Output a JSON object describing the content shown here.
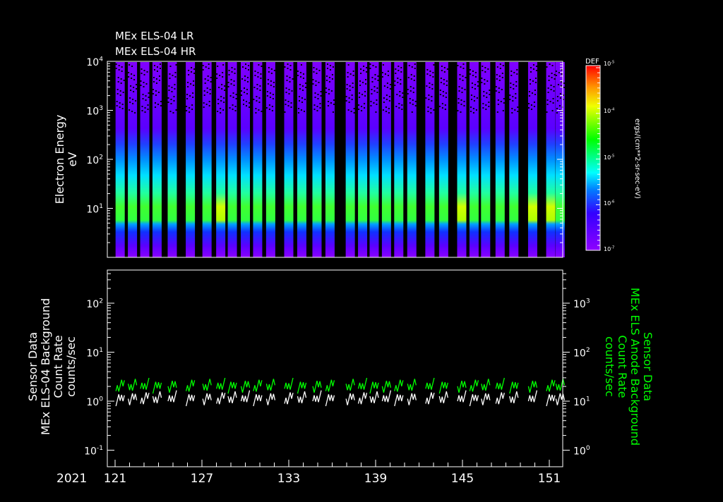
{
  "titles": [
    "MEx ELS-04 LR",
    "MEx ELS-04 HR"
  ],
  "year_label": "2021",
  "colors": {
    "background": "#000000",
    "axis": "#ffffff",
    "white_series": "#ffffff",
    "green_series": "#00ff00"
  },
  "chart_data": [
    {
      "type": "heatmap",
      "title": "MEx ELS-04 LR / HR",
      "ylabel": "Electron Energy",
      "yunits": "eV",
      "yscale": "log",
      "ylim": [
        1,
        10000
      ],
      "yticks": [
        "10^4",
        "10^3",
        "10^2",
        "10^1"
      ],
      "xlim": [
        121,
        151.93
      ],
      "colorbar": {
        "label": "DEF",
        "units": "ergs/(cm**2-sr-sec-eV)",
        "range": [
          1e-07,
          1e-05
        ],
        "ticks": [
          "10^-5",
          "10^-4",
          "10^-5",
          "10^-6",
          "10^-7"
        ]
      },
      "orbit_days": [
        121.35,
        122.2,
        123.05,
        123.9,
        124.95,
        126.2,
        127.35,
        128.3,
        129.1,
        130.0,
        130.85,
        131.75,
        133.0,
        133.9,
        134.95,
        135.85,
        137.25,
        138.1,
        138.9,
        139.75,
        140.6,
        141.5,
        142.75,
        143.7,
        144.95,
        145.8,
        146.6,
        147.6,
        148.55,
        149.85,
        151.1,
        151.75
      ],
      "orbit_peak_intensity": [
        0.55,
        0.6,
        0.55,
        0.6,
        0.6,
        0.55,
        0.7,
        0.72,
        0.65,
        0.6,
        0.62,
        0.6,
        0.55,
        0.6,
        0.62,
        0.58,
        0.62,
        0.65,
        0.6,
        0.62,
        0.55,
        0.6,
        0.55,
        0.6,
        0.72,
        0.65,
        0.6,
        0.62,
        0.58,
        0.75,
        0.78,
        0.7
      ]
    },
    {
      "type": "line",
      "ylabel_left": [
        "MEx ELS-04 Background",
        "Count Rate",
        "counts/sec"
      ],
      "ylabel_left_top": "Sensor Data",
      "ylabel_right": [
        "MEx ELS Anode Background",
        "Count Rate",
        "counts/sec"
      ],
      "ylabel_right_top": "Sensor Data",
      "yscale": "log",
      "ylim_left": [
        0.05,
        500
      ],
      "ylim_right": [
        0.5,
        5000
      ],
      "yticks_left": [
        "10^2",
        "10^1",
        "10^0",
        "10^-1"
      ],
      "yticks_right": [
        "10^3",
        "10^2",
        "10^1",
        "10^0"
      ],
      "xlim": [
        121,
        151.93
      ],
      "xticks": [
        "121",
        "127",
        "133",
        "139",
        "145",
        "151"
      ],
      "xtick_values": [
        121,
        127,
        133,
        139,
        145,
        151
      ],
      "series": [
        {
          "name": "ELS-04 Background (white, left axis)",
          "color": "#ffffff",
          "level": 1.0
        },
        {
          "name": "Anode Background (green, right axis)",
          "color": "#00ff00",
          "level": 18
        }
      ]
    }
  ]
}
